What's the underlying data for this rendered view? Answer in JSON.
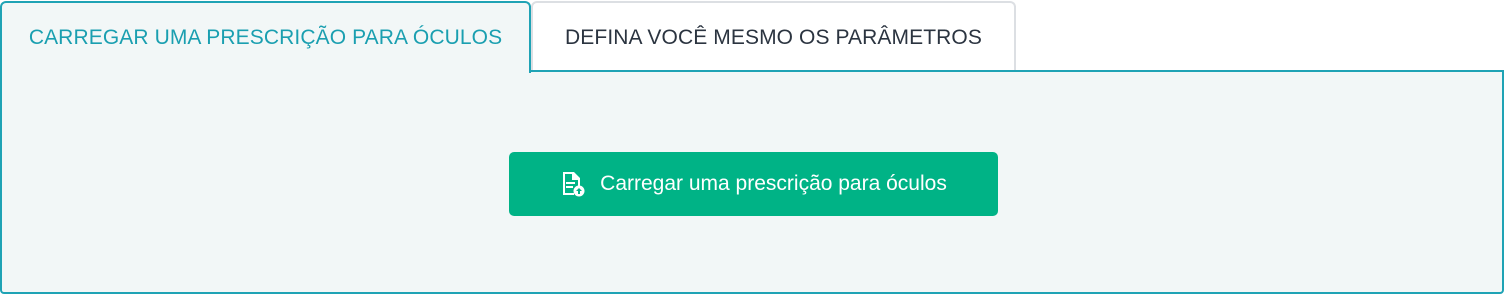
{
  "tabs": [
    {
      "label": "CARREGAR UMA PRESCRIÇÃO PARA ÓCULOS",
      "active": true
    },
    {
      "label": "DEFINA VOCÊ MESMO OS PARÂMETROS",
      "active": false
    }
  ],
  "panel": {
    "upload_button": {
      "label": "Carregar uma prescrição para óculos",
      "icon": "document-upload-icon"
    }
  },
  "colors": {
    "accent": "#1fa3b5",
    "active_tab_text": "#1a9fb0",
    "inactive_tab_text": "#2b3440",
    "panel_bg": "#f2f7f7",
    "button_bg": "#00b386",
    "button_text": "#ffffff"
  }
}
